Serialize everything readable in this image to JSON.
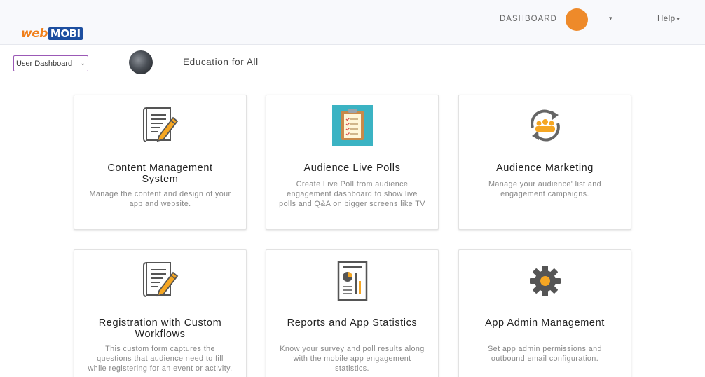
{
  "header": {
    "logo_web": "web",
    "logo_mobi": "MOBI",
    "nav_dashboard": "DASHBOARD",
    "user_caret": "▾",
    "help_label": "Help",
    "help_caret": "▾",
    "avatar_color": "#ee8a2a"
  },
  "toolbar": {
    "dashboard_select_value": "User Dashboard",
    "org_name": "Education for All"
  },
  "cards": [
    {
      "title": "Content Management System",
      "desc": "Manage the content and design of your app and website.",
      "icon": "document-edit-icon"
    },
    {
      "title": "Audience Live Polls",
      "desc": "Create Live Poll from audience engagement dashboard to show live polls and Q&A on bigger screens like TV",
      "icon": "clipboard-checklist-icon"
    },
    {
      "title": "Audience Marketing",
      "desc": "Manage your audience' list and engagement campaigns.",
      "icon": "audience-cycle-icon"
    },
    {
      "title": "Registration with Custom Workflows",
      "desc": "This custom form captures the questions that audience need to fill while registering for an event or activity.",
      "icon": "document-edit-icon"
    },
    {
      "title": "Reports and App Statistics",
      "desc": "Know your survey and poll results along with the mobile app engagement statistics.",
      "icon": "report-chart-icon"
    },
    {
      "title": "App Admin Management",
      "desc": "Set app admin permissions and outbound email configuration.",
      "icon": "gear-icon"
    }
  ],
  "colors": {
    "accent_orange": "#ee8a2a",
    "brand_blue": "#1d4fa0",
    "select_border": "#9b59b6"
  }
}
